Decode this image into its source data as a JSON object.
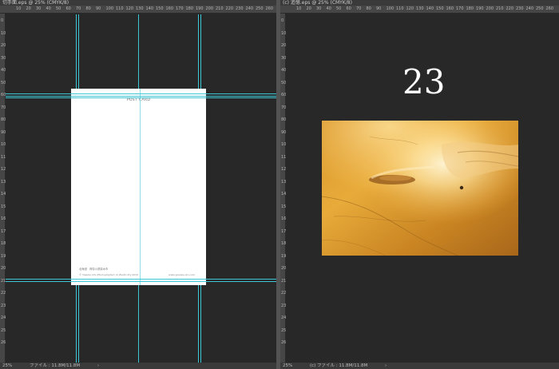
{
  "left_doc": {
    "tab_title": "切手面.eps @ 25% (CMYK/8)",
    "zoom": "25%",
    "file_info": "ファイル : 11.8M/11.8M",
    "postcard": {
      "title": "POST CARD",
      "address": "北海道　神奈川県厚木市",
      "credit": "© Yusuke Oto Photographer, in Zushi city 2012",
      "url": "www.yusuke-oto.com"
    }
  },
  "right_doc": {
    "tab_title": "(c) 追憶.eps @ 25% (CMYK/8)",
    "zoom": "25%",
    "file_info": "(c) ファイル : 11.8M/11.8M",
    "page_number": "23",
    "photo_subject": "sand-beach-photo"
  },
  "ruler_top_labels": [
    "10",
    "20",
    "30",
    "40",
    "50",
    "60",
    "70",
    "80",
    "90",
    "100",
    "110",
    "120",
    "130",
    "140",
    "150",
    "160",
    "170",
    "180",
    "190",
    "200",
    "210",
    "220",
    "230",
    "240",
    "250",
    "260",
    "270"
  ],
  "ruler_left_labels": [
    "0",
    "10",
    "20",
    "30",
    "40",
    "50",
    "60",
    "70",
    "80",
    "90",
    "100",
    "110",
    "120",
    "130",
    "140",
    "150",
    "160",
    "170",
    "180",
    "190",
    "200",
    "210",
    "220",
    "230",
    "240",
    "250",
    "260"
  ],
  "colors": {
    "guide": "#3cc6d6",
    "pasteboard": "#282828",
    "panel": "#3a3a3a"
  }
}
